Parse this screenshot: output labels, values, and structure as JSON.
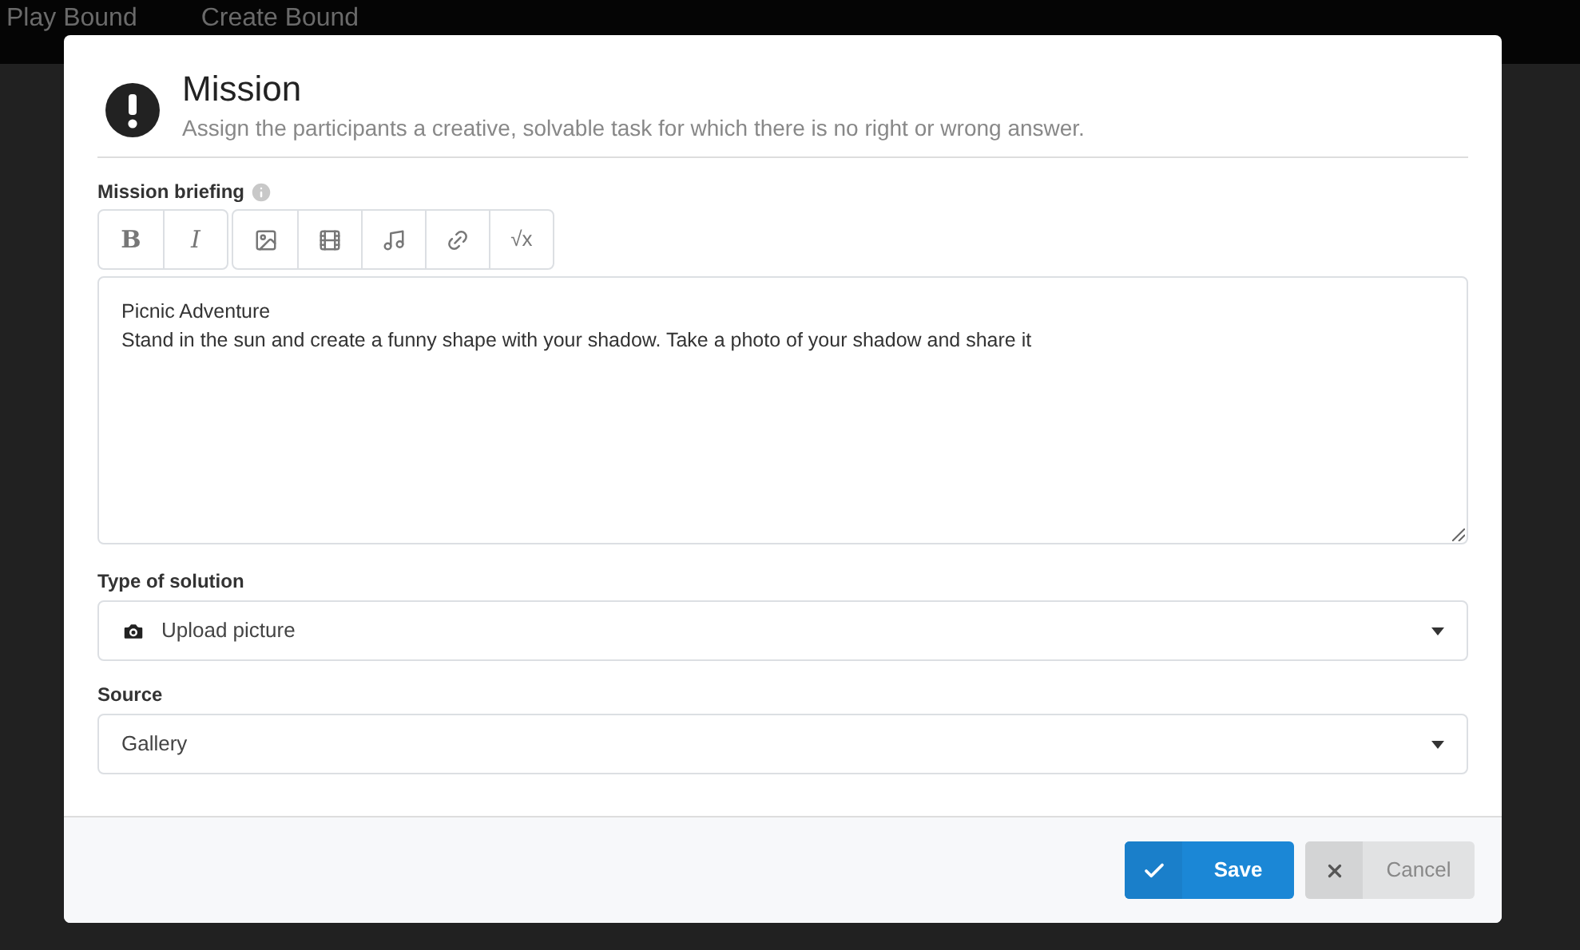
{
  "nav": [
    "Play Bound",
    "Create Bound"
  ],
  "dialog": {
    "title": "Mission",
    "subtitle": "Assign the participants a creative, solvable task for which there is no right or wrong answer.",
    "briefing": {
      "label": "Mission briefing",
      "lines": [
        "Picnic Adventure",
        "Stand in the sun and create a funny shape with your shadow. Take a photo of your shadow and share it"
      ]
    },
    "toolbar": [
      [
        {
          "kind": "bold",
          "label": "B"
        },
        {
          "kind": "italic",
          "label": "I"
        }
      ],
      [
        {
          "kind": "image"
        },
        {
          "kind": "film"
        },
        {
          "kind": "music"
        },
        {
          "kind": "link"
        },
        {
          "kind": "formula",
          "label": "√x"
        }
      ]
    ],
    "solution": {
      "label": "Type of solution",
      "value": "Upload picture"
    },
    "source": {
      "label": "Source",
      "value": "Gallery"
    },
    "buttons": [
      {
        "kind": "save",
        "label": "Save"
      },
      {
        "kind": "cancel",
        "label": "Cancel"
      }
    ]
  }
}
